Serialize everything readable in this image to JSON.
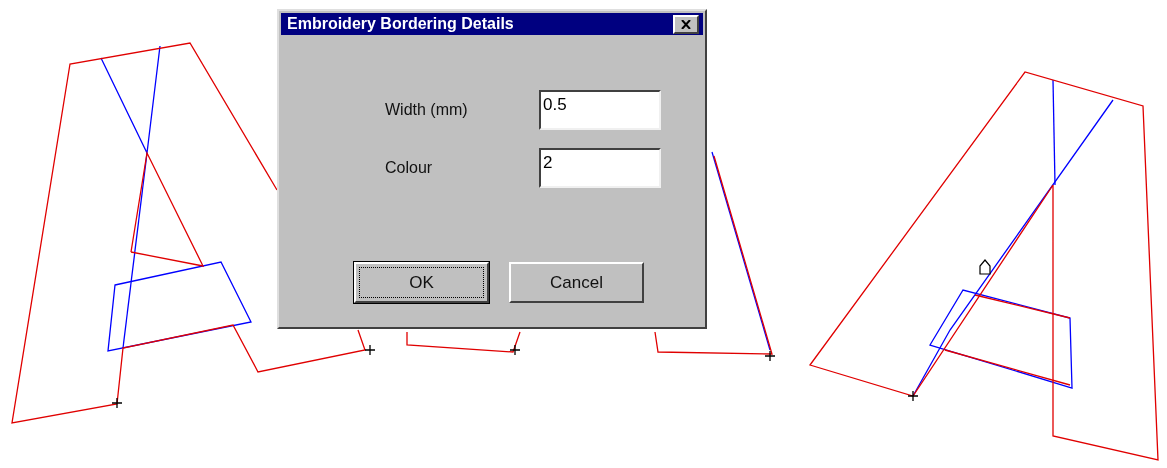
{
  "dialog": {
    "title": "Embroidery Bordering Details",
    "fields": [
      {
        "label": "Width (mm)",
        "value": "0.5"
      },
      {
        "label": "Colour",
        "value": "2"
      }
    ],
    "buttons": [
      {
        "label": "OK",
        "default": true
      },
      {
        "label": "Cancel",
        "default": false
      }
    ]
  }
}
